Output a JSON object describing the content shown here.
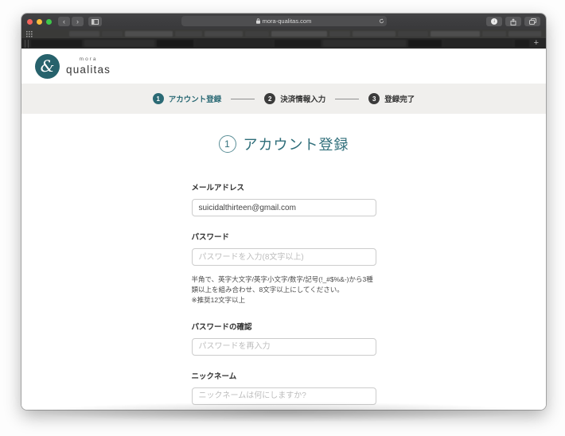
{
  "browser": {
    "url": "mora-qualitas.com",
    "back_label": "‹",
    "forward_label": "›",
    "new_tab_label": "+"
  },
  "brand": {
    "name_top": "mora",
    "name_bottom": "qualitas",
    "logo_glyph": "&",
    "accent_color": "#2b6a75"
  },
  "stepper": {
    "steps": [
      {
        "number": "1",
        "label": "アカウント登録"
      },
      {
        "number": "2",
        "label": "決済情報入力"
      },
      {
        "number": "3",
        "label": "登録完了"
      }
    ]
  },
  "page": {
    "heading_number": "1",
    "heading": "アカウント登録"
  },
  "form": {
    "email": {
      "label": "メールアドレス",
      "value": "suicidalthirteen@gmail.com"
    },
    "password": {
      "label": "パスワード",
      "placeholder": "パスワードを入力(8文字以上)",
      "help": "半角で、英字大文字/英字小文字/数字/記号(!_#$%&-)から3種類以上を組み合わせ、8文字以上にしてください。",
      "help_note": "※推奨12文字以上"
    },
    "password_confirm": {
      "label": "パスワードの確認",
      "placeholder": "パスワードを再入力"
    },
    "nickname": {
      "label": "ニックネーム",
      "placeholder": "ニックネームは何にしますか?"
    }
  }
}
